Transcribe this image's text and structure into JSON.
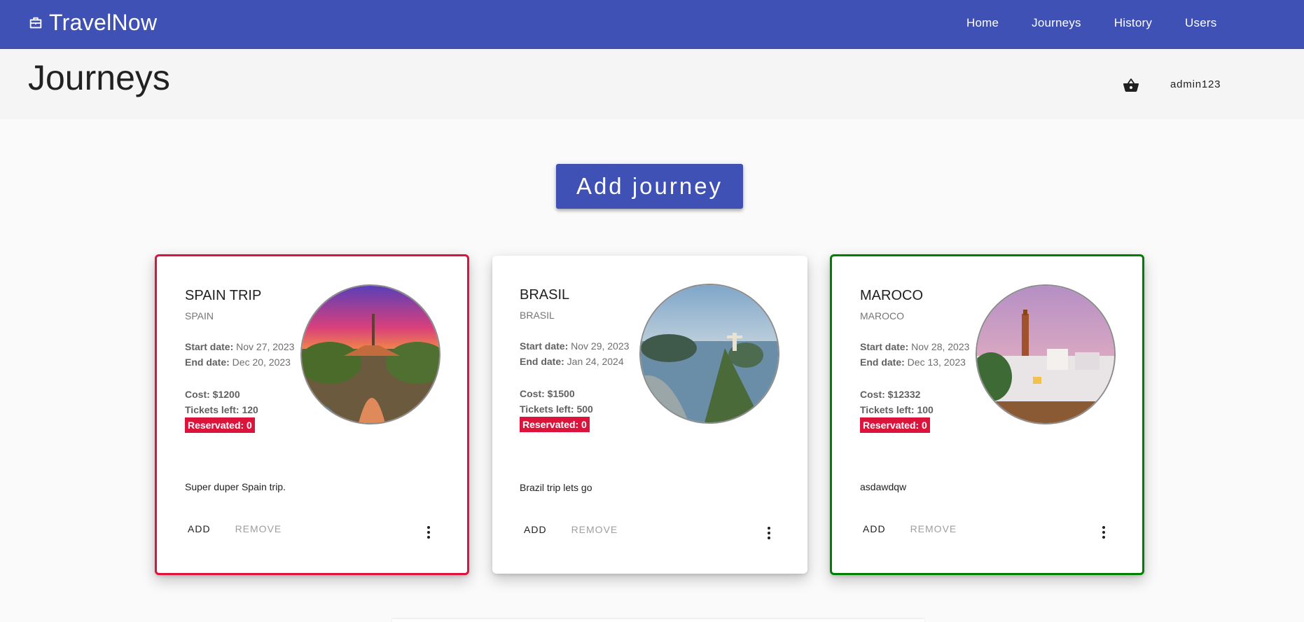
{
  "app": {
    "brand": "TravelNow",
    "brand_icon": "briefcase-icon"
  },
  "nav": {
    "items": [
      "Home",
      "Journeys",
      "History",
      "Users"
    ]
  },
  "page": {
    "title": "Journeys",
    "cart_icon": "basket-icon",
    "user": "admin123"
  },
  "actions": {
    "add_journey": "Add journey"
  },
  "colors": {
    "primary": "#3f51b5",
    "danger": "#dc143c",
    "success": "#008000"
  },
  "cards": [
    {
      "title": "SPAIN TRIP",
      "subtitle": "SPAIN",
      "start_label": "Start date:",
      "start": "Nov 27, 2023",
      "end_label": "End date:",
      "end": "Dec 20, 2023",
      "cost_label": "Cost:",
      "cost": "$1200",
      "tickets_label": "Tickets left:",
      "tickets": "120",
      "reserved": "Reservated: 0",
      "description": "Super duper Spain trip.",
      "add": "ADD",
      "remove": "REMOVE"
    },
    {
      "title": "BRASIL",
      "subtitle": "BRASIL",
      "start_label": "Start date:",
      "start": "Nov 29, 2023",
      "end_label": "End date:",
      "end": "Jan 24, 2024",
      "cost_label": "Cost:",
      "cost": "$1500",
      "tickets_label": "Tickets left:",
      "tickets": "500",
      "reserved": "Reservated: 0",
      "description": "Brazil trip lets go",
      "add": "ADD",
      "remove": "REMOVE"
    },
    {
      "title": "MAROCO",
      "subtitle": "MAROCO",
      "start_label": "Start date:",
      "start": "Nov 28, 2023",
      "end_label": "End date:",
      "end": "Dec 13, 2023",
      "cost_label": "Cost:",
      "cost": "$12332",
      "tickets_label": "Tickets left:",
      "tickets": "100",
      "reserved": "Reservated: 0",
      "description": "asdawdqw",
      "add": "ADD",
      "remove": "REMOVE"
    }
  ]
}
